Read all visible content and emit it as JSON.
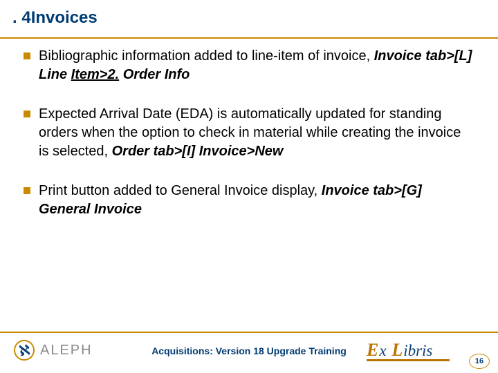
{
  "title_prefix": ". 4",
  "title_main": "Invoices",
  "bullets": [
    {
      "text": "Bibliographic information added to line-item of invoice, ",
      "path_plain1": "Invoice tab>[L] Line ",
      "path_underlined": "Item>2.",
      "path_plain2": " Order Info"
    },
    {
      "text": "Expected Arrival Date (EDA) is automatically updated for standing orders when the option to check in material while creating the invoice is selected, ",
      "path_plain1": "Order tab>[I] Invoice>New",
      "path_underlined": "",
      "path_plain2": ""
    },
    {
      "text": "Print button added to General Invoice display, ",
      "path_plain1": "Invoice tab>[G] General Invoice",
      "path_underlined": "",
      "path_plain2": ""
    }
  ],
  "footer": {
    "aleph_brand": "ALEPH",
    "aleph_glyph": "ℵ",
    "training_title": "Acquisitions: Version 18 Upgrade Training",
    "exlibris_E": "E",
    "exlibris_x": "x ",
    "exlibris_L": "L",
    "exlibris_ibris": "ibris",
    "page_number": "16"
  }
}
